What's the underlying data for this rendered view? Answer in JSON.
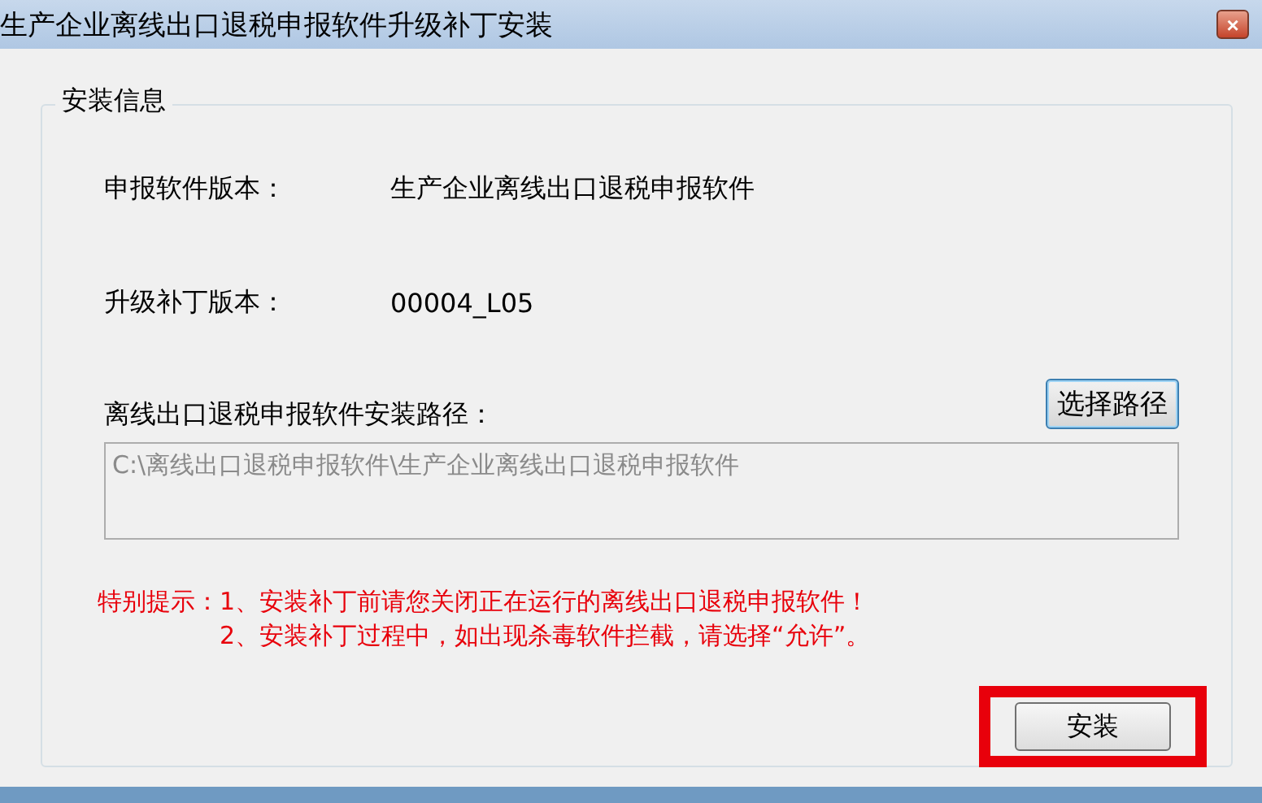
{
  "window": {
    "title": "生产企业离线出口退税申报软件升级补丁安装",
    "close": "×"
  },
  "group": {
    "title": "安装信息"
  },
  "fields": [
    {
      "label": "申报软件版本：",
      "value": "生产企业离线出口退税申报软件"
    },
    {
      "label": "升级补丁版本：",
      "value": "00004_L05"
    }
  ],
  "path": {
    "label": "离线出口退税申报软件安装路径：",
    "button": "选择路径",
    "value": "C:\\离线出口退税申报软件\\生产企业离线出口退税申报软件",
    "disabled": true
  },
  "warning": {
    "prefix": "特别提示：",
    "lines": [
      "1、安装补丁前请您关闭正在运行的离线出口退税申报软件！",
      "2、安装补丁过程中，如出现杀毒软件拦截，请选择“允许”。"
    ]
  },
  "install_button": {
    "label": "安装",
    "highlighted": true
  }
}
